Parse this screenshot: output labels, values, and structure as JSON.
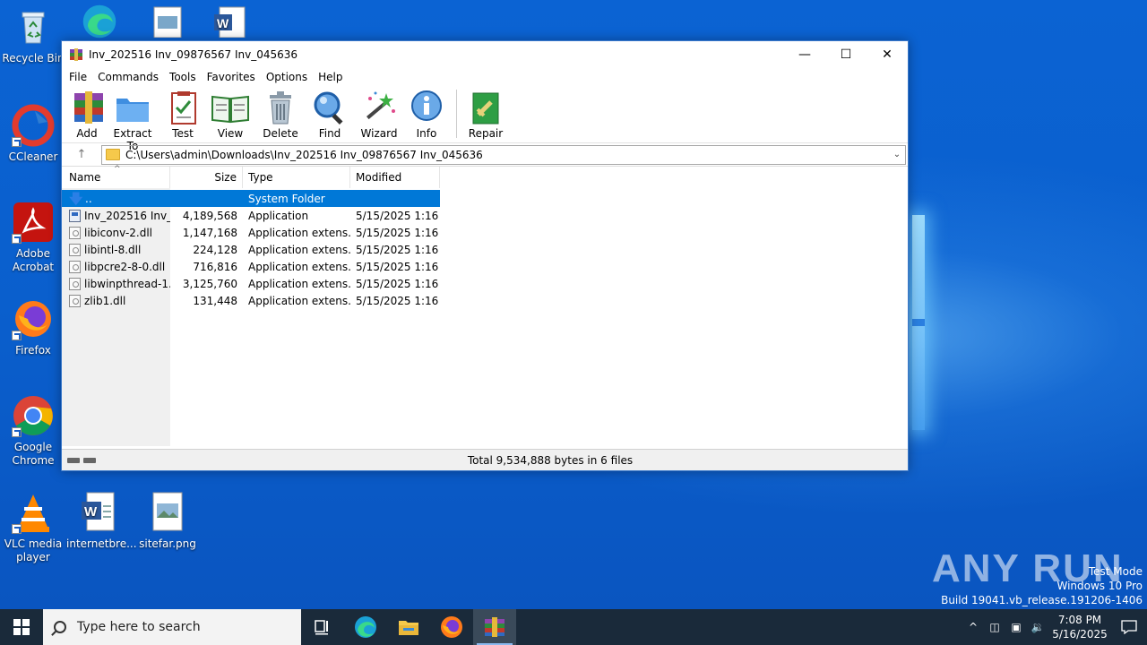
{
  "desktop": {
    "icons": [
      {
        "label": "Recycle Bin"
      },
      {
        "label": "CCleaner"
      },
      {
        "label": "Adobe Acrobat"
      },
      {
        "label": "Firefox"
      },
      {
        "label": "Google Chrome"
      },
      {
        "label": "VLC media player"
      },
      {
        "label": "internetbre..."
      },
      {
        "label": "sitefar.png"
      }
    ]
  },
  "window": {
    "title": "Inv_202516 Inv_09876567 Inv_045636",
    "menu": [
      "File",
      "Commands",
      "Tools",
      "Favorites",
      "Options",
      "Help"
    ],
    "toolbar": [
      "Add",
      "Extract To",
      "Test",
      "View",
      "Delete",
      "Find",
      "Wizard",
      "Info",
      "Repair"
    ],
    "address": "C:\\Users\\admin\\Downloads\\Inv_202516 Inv_09876567 Inv_045636",
    "columns": {
      "name": "Name",
      "size": "Size",
      "type": "Type",
      "modified": "Modified"
    },
    "files": [
      {
        "name": "..",
        "size": "",
        "type": "System Folder",
        "modified": ""
      },
      {
        "name": "Inv_202516 Inv_0...",
        "size": "4,189,568",
        "type": "Application",
        "modified": "5/15/2025 1:16 ..."
      },
      {
        "name": "libiconv-2.dll",
        "size": "1,147,168",
        "type": "Application extens...",
        "modified": "5/15/2025 1:16 ..."
      },
      {
        "name": "libintl-8.dll",
        "size": "224,128",
        "type": "Application extens...",
        "modified": "5/15/2025 1:16 ..."
      },
      {
        "name": "libpcre2-8-0.dll",
        "size": "716,816",
        "type": "Application extens...",
        "modified": "5/15/2025 1:16 ..."
      },
      {
        "name": "libwinpthread-1....",
        "size": "3,125,760",
        "type": "Application extens...",
        "modified": "5/15/2025 1:16 ..."
      },
      {
        "name": "zlib1.dll",
        "size": "131,448",
        "type": "Application extens...",
        "modified": "5/15/2025 1:16 ..."
      }
    ],
    "status": "Total 9,534,888 bytes in 6 files"
  },
  "watermark": {
    "text": "ANY RUN",
    "test_mode": "Test Mode",
    "edition": "Windows 10 Pro",
    "build": "Build 19041.vb_release.191206-1406"
  },
  "taskbar": {
    "search_placeholder": "Type here to search",
    "time": "7:08 PM",
    "date": "5/16/2025"
  }
}
